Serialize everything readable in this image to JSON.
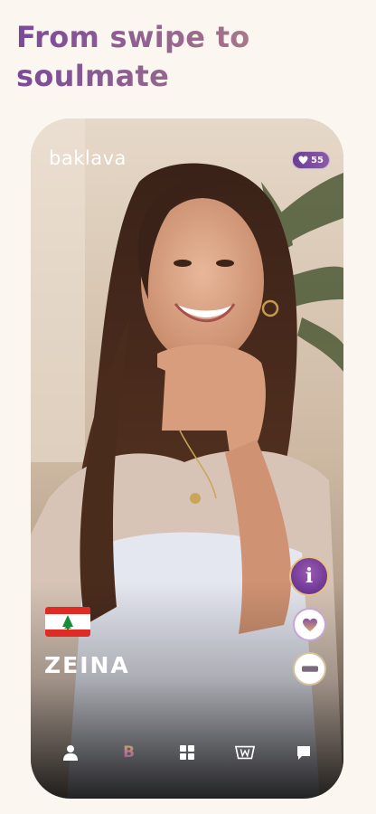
{
  "headline": "From swipe to soulmate",
  "card": {
    "brand": "baklava",
    "likes_count": "55",
    "flag": "lebanon-flag-icon",
    "name": "ZEINA",
    "actions": [
      "info-button",
      "like-button",
      "skip-button"
    ]
  },
  "nav": {
    "items": [
      "profile-icon",
      "home-b-icon",
      "grid-icon",
      "crown-icon",
      "chat-icon"
    ],
    "active": "home-b-icon",
    "home_label": "B"
  },
  "colors": {
    "brand_purple": "#6a3492",
    "accent_gold": "#e8c27a",
    "background": "#fbf6ef"
  }
}
